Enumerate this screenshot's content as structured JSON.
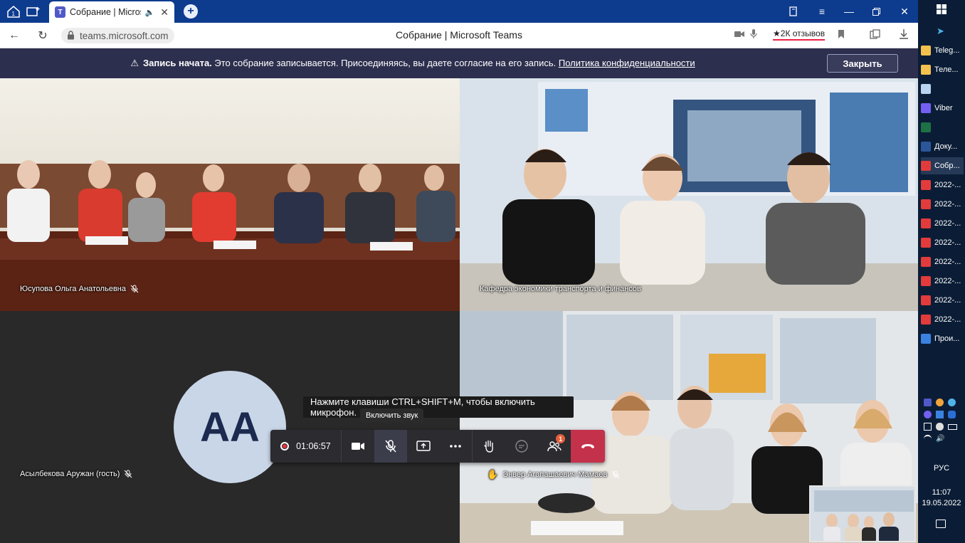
{
  "browser": {
    "tab_title": "Собрание | Microsoft",
    "url": "teams.microsoft.com",
    "page_title": "Собрание | Microsoft Teams",
    "reviews": "2К отзывов"
  },
  "banner": {
    "bold": "Запись начата.",
    "text": "Это собрание записывается. Присоединяясь, вы даете согласие на его запись.",
    "link": "Политика конфиденциальности",
    "close_label": "Закрыть"
  },
  "participants": {
    "p1": "Юсупова Ольга Анатольевна",
    "p2": "Кафедра экономики транспорта и финансов",
    "p3": "Асылбекова Аружан (гость)",
    "p3_initials": "АА",
    "p4": "Энвер Агапашаевич Мамаев"
  },
  "toast": "Нажмите клавиши CTRL+SHIFT+M, чтобы включить микрофон.",
  "tooltip": "Включить звук",
  "toolbar": {
    "timer": "01:06:57",
    "participants_badge": "1"
  },
  "taskbar": {
    "items": [
      {
        "label": "Teleg...",
        "color": "#f2c14e"
      },
      {
        "label": "Теле...",
        "color": "#f2c14e"
      },
      {
        "label": "",
        "color": "#b8d4f0"
      },
      {
        "label": "Viber",
        "color": "#7360f2"
      },
      {
        "label": "",
        "color": "#1e7145"
      },
      {
        "label": "Доку...",
        "color": "#2b579a"
      },
      {
        "label": "Собр...",
        "color": "#e23b3b"
      },
      {
        "label": "2022-...",
        "color": "#e23b3b"
      },
      {
        "label": "2022-...",
        "color": "#e23b3b"
      },
      {
        "label": "2022-...",
        "color": "#e23b3b"
      },
      {
        "label": "2022-...",
        "color": "#e23b3b"
      },
      {
        "label": "2022-...",
        "color": "#e23b3b"
      },
      {
        "label": "2022-...",
        "color": "#e23b3b"
      },
      {
        "label": "2022-...",
        "color": "#e23b3b"
      },
      {
        "label": "2022-...",
        "color": "#e23b3b"
      },
      {
        "label": "Прои...",
        "color": "#3b82e0"
      }
    ],
    "lang": "РУС",
    "time": "11:07",
    "date": "19.05.2022"
  },
  "colors": {
    "browser_blue": "#0d3b8e",
    "banner_bg": "#2d2f4e",
    "hangup_red": "#c4314b",
    "avatar_bg": "#c9d6e8",
    "avatar_text": "#1b2a4e"
  }
}
